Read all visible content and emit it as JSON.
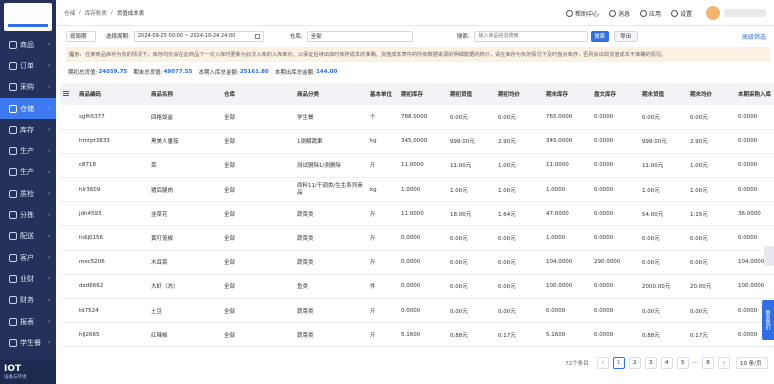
{
  "sidebar": {
    "items": [
      {
        "label": "商品",
        "arrow": "›"
      },
      {
        "label": "订单",
        "arrow": "›"
      },
      {
        "label": "采购",
        "arrow": "›"
      },
      {
        "label": "仓储",
        "arrow": "›"
      },
      {
        "label": "库存",
        "arrow": "›"
      },
      {
        "label": "生产",
        "arrow": "›"
      },
      {
        "label": "生产",
        "arrow": "›"
      },
      {
        "label": "质检",
        "arrow": "›"
      },
      {
        "label": "分拣",
        "arrow": "›"
      },
      {
        "label": "配送",
        "arrow": "›"
      },
      {
        "label": "客户",
        "arrow": "›"
      },
      {
        "label": "业财",
        "arrow": "›"
      },
      {
        "label": "财务",
        "arrow": "›"
      },
      {
        "label": "报表",
        "arrow": "›"
      },
      {
        "label": "学生餐",
        "arrow": "›"
      }
    ],
    "iot_title": "IOT",
    "iot_sub": "设备与环境"
  },
  "breadcrumb": {
    "home": "仓储",
    "sep1": "/",
    "section": "库存账表",
    "sep2": "/",
    "current": "货值成本表"
  },
  "topbar": {
    "help": "帮助中心",
    "msg": "消息",
    "apps": "应用",
    "settings": "设置"
  },
  "filters": {
    "mode": "按周期",
    "period_label": "选择周期:",
    "period_value": "2024-09-25 00:00 ~ 2024-10-24 24:00",
    "warehouse_label": "仓库:",
    "warehouse_value": "全部",
    "search_label": "搜索:",
    "search_placeholder": "输入商品信息搜索",
    "search_btn": "搜索",
    "export_btn": "导出",
    "advanced": "高级筛选"
  },
  "tip": {
    "label": "提示:",
    "text": "在某商品库存为负的情况下，库存均价会在此商品下一次入库时更新为此次入库的入库单价，以保证后续出库时库存成本的准确。货值成本表中的所有数据来源的明细数据的统计，请在库存为负的情况下及时盘点库存，否则会出现货值成本不准确的情况。"
  },
  "summary": {
    "l1": "期初总货值:",
    "v1": "24059.75",
    "l2": "期末总货值:",
    "v2": "49077.55",
    "l3": "本期入库总金额:",
    "v3": "25161.80",
    "l4": "本期出库总金额:",
    "v4": "144.00"
  },
  "table": {
    "headers": [
      "商品编码",
      "商品名称",
      "仓库",
      "商品分类",
      "基本单位",
      "期初库存",
      "期初货值",
      "期初均价",
      "期末库存",
      "盘文库存",
      "期末货值",
      "期末均价",
      "本期采购入库"
    ],
    "rows": [
      [
        "sgfh5377",
        "四格饭盒",
        "全部",
        "学生餐",
        "个",
        "788.0000",
        "0.00元",
        "0.00元",
        "765.0000",
        "0.0000",
        "0.00元",
        "0.00元",
        "0.0000"
      ],
      [
        "hmrpt3833",
        "黑美人番茄",
        "全部",
        "1测解蔬果",
        "kg",
        "345.0000",
        "999.00元",
        "2.90元",
        "345.0000",
        "0.0000",
        "999.00元",
        "2.90元",
        "0.0000"
      ],
      [
        "c8718",
        "菜",
        "全部",
        "测试删除1/测删除",
        "斤",
        "11.0000",
        "11.00元",
        "1.00元",
        "11.0000",
        "0.0000",
        "11.00元",
        "1.00元",
        "0.0000"
      ],
      [
        "hlr3609",
        "猪后腿肉",
        "全部",
        "原料11/干调类/生生系列商品",
        "kg",
        "1.0000",
        "1.00元",
        "1.00元",
        "1.0000",
        "0.0000",
        "1.00元",
        "1.00元",
        "0.0000"
      ],
      [
        "jdh4593",
        "韭菜花",
        "全部",
        "蔬菜类",
        "斤",
        "11.0000",
        "18.00元",
        "1.64元",
        "47.0000",
        "0.0000",
        "54.00元",
        "1.15元",
        "36.0000"
      ],
      [
        "hdlj0156",
        "黄叮笼椒",
        "全部",
        "蔬菜类",
        "斤",
        "0.0000",
        "0.00元",
        "0.00元",
        "1.0000",
        "0.0000",
        "0.00元",
        "0.00元",
        "0.0000"
      ],
      [
        "mec5206",
        "木耳菜",
        "全部",
        "蔬菜类",
        "斤",
        "0.0000",
        "0.00元",
        "0.00元",
        "104.0000",
        "290.0000",
        "0.00元",
        "0.00元",
        "104.0000"
      ],
      [
        "dxd6662",
        "大虾（冻）",
        "全部",
        "鱼类",
        "件",
        "0.0000",
        "0.00元",
        "0.00元",
        "100.0000",
        "0.0000",
        "2000.00元",
        "20.00元",
        "100.0000"
      ],
      [
        "td7524",
        "土豆",
        "全部",
        "蔬菜类",
        "斤",
        "0.0000",
        "0.00元",
        "0.00元",
        "0.0000",
        "0.0000",
        "0.00元",
        "0.00元",
        "0.0000"
      ],
      [
        "hlj2665",
        "红辣椒",
        "全部",
        "蔬菜类",
        "斤",
        "5.1600",
        "0.88元",
        "0.17元",
        "5.1600",
        "0.0000",
        "0.88元",
        "0.17元",
        "0.0000"
      ]
    ]
  },
  "pagination": {
    "total": "72个条目",
    "prev": "‹",
    "pages": [
      "1",
      "2",
      "3",
      "4",
      "5"
    ],
    "ellipsis": "···",
    "last": "8",
    "next": "›",
    "page_size": "10 条/页"
  },
  "side_tab": "联系我们",
  "colors": {
    "sidebar": "#24325b",
    "accent": "#2e6fe8",
    "tip_bg": "#fdf1e3"
  }
}
